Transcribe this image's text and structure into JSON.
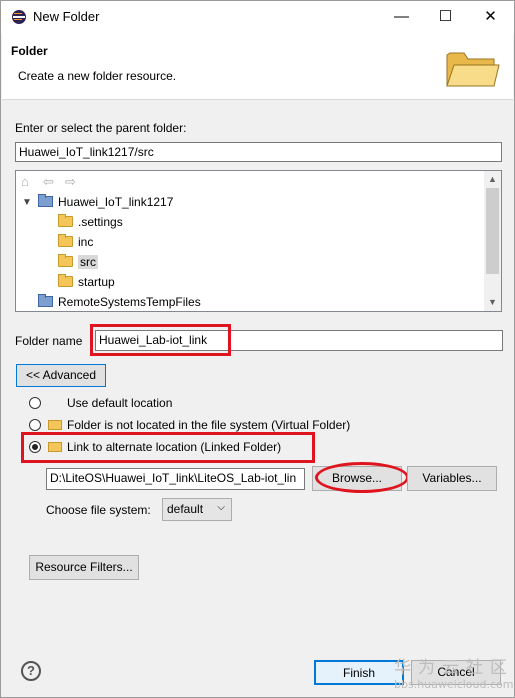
{
  "window": {
    "title": "New Folder",
    "minimize": "—",
    "maximize": "☐",
    "close": "✕"
  },
  "header": {
    "title": "Folder",
    "description": "Create a new folder resource."
  },
  "parent": {
    "label": "Enter or select the parent folder:",
    "value": "Huawei_IoT_link1217/src"
  },
  "tree": {
    "toolbar": {
      "home": "⌂",
      "back": "⇦",
      "forward": "⇨"
    },
    "items": [
      {
        "label": "Huawei_IoT_link1217",
        "expanded": true
      },
      {
        "label": ".settings"
      },
      {
        "label": "inc"
      },
      {
        "label": "src",
        "selected": true
      },
      {
        "label": "startup"
      },
      {
        "label": "RemoteSystemsTempFiles"
      }
    ]
  },
  "folder_name": {
    "label": "Folder name",
    "value": "Huawei_Lab-iot_link"
  },
  "advanced_button": "<< Advanced",
  "options": {
    "default_location": "Use default location",
    "virtual_folder": "Folder is not located in the file system (Virtual Folder)",
    "linked_folder": "Link to alternate location (Linked Folder)",
    "selected": "linked_folder"
  },
  "location": {
    "value": "D:\\LiteOS\\Huawei_IoT_link\\LiteOS_Lab-iot_lin",
    "browse": "Browse...",
    "variables": "Variables..."
  },
  "file_system": {
    "label": "Choose file system:",
    "value": "default"
  },
  "resource_filters": "Resource Filters...",
  "footer": {
    "help": "?",
    "finish": "Finish",
    "cancel": "Cancel"
  },
  "watermark": {
    "top": "华为云社区",
    "bottom": "bbs.huaweicloud.com"
  },
  "colors": {
    "annotation_red": "#e0141e",
    "selection": "#d9d9d9"
  }
}
